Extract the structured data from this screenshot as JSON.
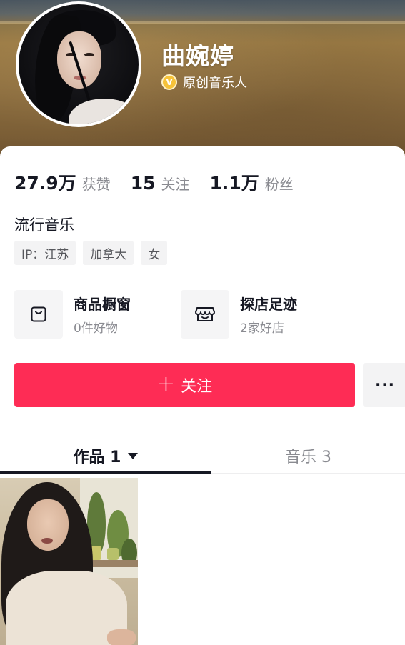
{
  "profile": {
    "name": "曲婉婷",
    "verify_icon_glyph": "V",
    "verified_label": "原创音乐人"
  },
  "stats": [
    {
      "value": "27.9万",
      "label": "获赞"
    },
    {
      "value": "15",
      "label": "关注"
    },
    {
      "value": "1.1万",
      "label": "粉丝"
    }
  ],
  "bio": "流行音乐",
  "tags": [
    "IP：江苏",
    "加拿大",
    "女"
  ],
  "services": [
    {
      "title": "商品橱窗",
      "subtitle": "0件好物",
      "icon": "shopping-bag-icon"
    },
    {
      "title": "探店足迹",
      "subtitle": "2家好店",
      "icon": "store-icon"
    }
  ],
  "actions": {
    "follow_plus": "+",
    "follow_label": "关注",
    "more_label": "···"
  },
  "tabs": [
    {
      "label": "作品 1",
      "active": true
    },
    {
      "label": "音乐 3",
      "active": false
    }
  ],
  "colors": {
    "follow_button": "#fe2c55",
    "verify_badge": "#f6c33a",
    "primary_text": "#161823",
    "secondary_text": "#8a8b91"
  }
}
